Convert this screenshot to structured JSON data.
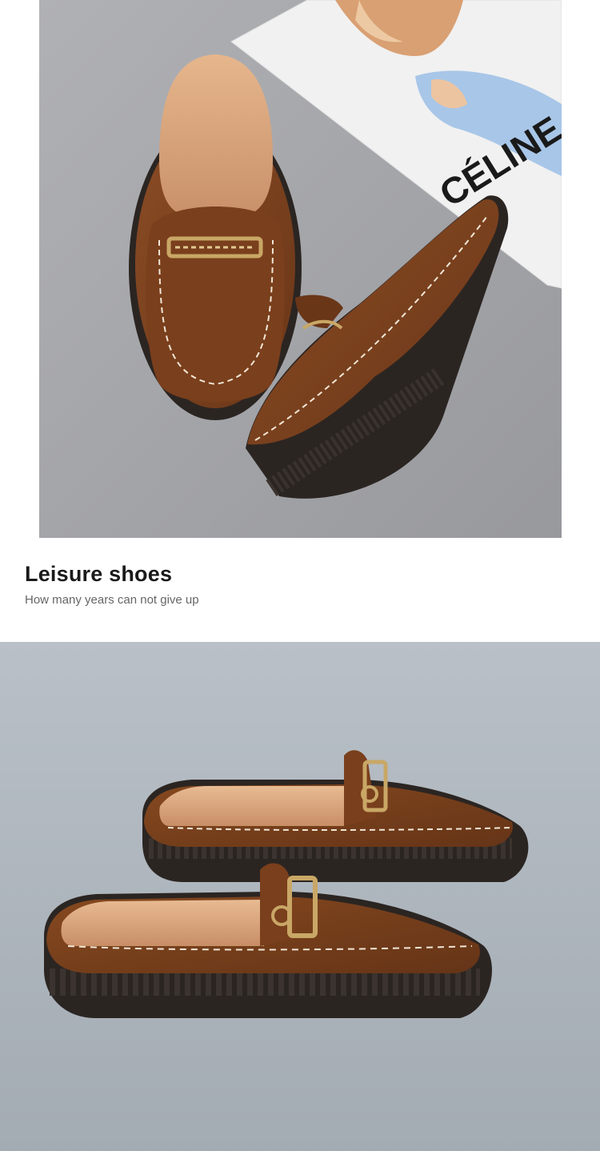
{
  "photos": {
    "top": {
      "magazine_text": "CÉLINE"
    }
  },
  "caption": {
    "title": "Leisure shoes",
    "subtitle": "How many years can not give up"
  },
  "colors": {
    "suede": "#7a4320",
    "suede_dark": "#5c2f14",
    "lining": "#d9a57b",
    "sole": "#2b2522",
    "buckle": "#c9a766",
    "background_top": "#a4a5a9",
    "background_bottom": "#b0b8bf"
  }
}
